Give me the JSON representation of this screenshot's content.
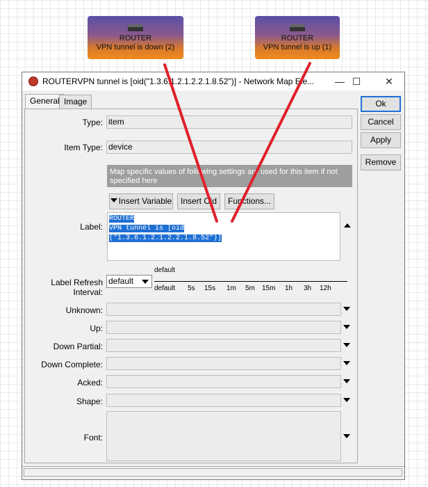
{
  "map_nodes": [
    {
      "name": "ROUTER",
      "status": "VPN tunnel is down (2)"
    },
    {
      "name": "ROUTER",
      "status": "VPN tunnel is up (1)"
    }
  ],
  "window": {
    "title": "ROUTERVPN tunnel is [oid(\"1.3.6.1.2.1.2.2.1.8.52\")] - Network Map Ele...",
    "controls": {
      "minimize": "—",
      "maximize": "☐",
      "close": "✕"
    }
  },
  "tabs": [
    {
      "label": "General"
    },
    {
      "label": "Image"
    }
  ],
  "form": {
    "type_label": "Type:",
    "type_value": "item",
    "item_type_label": "Item Type:",
    "item_type_value": "device",
    "info_text": "Map specific values of following settings are used for this item if not specified here",
    "insert_variable": "Insert Variable",
    "insert_oid": "Insert Oid",
    "functions": "Functions...",
    "label_label": "Label:",
    "label_lines": [
      "ROUTER",
      "VPN tunnel is [oid",
      "(\"1.3.6.1.2.1.2.2.1.8.52\")]"
    ],
    "refresh_label": "Label Refresh Interval:",
    "refresh_value": "default",
    "slider_value_label": "default",
    "slider_ticks": [
      "default",
      "5s",
      "15s",
      "1m",
      "5m",
      "15m",
      "1h",
      "3h",
      "12h"
    ],
    "unknown_label": "Unknown:",
    "up_label": "Up:",
    "down_partial_label": "Down Partial:",
    "down_complete_label": "Down Complete:",
    "acked_label": "Acked:",
    "shape_label": "Shape:",
    "font_label": "Font:"
  },
  "buttons": {
    "ok": "Ok",
    "cancel": "Cancel",
    "apply": "Apply",
    "remove": "Remove"
  },
  "colors": {
    "selection": "#1e6fd4",
    "annotation_line": "#e0202a"
  },
  "icons": [
    "router-icon",
    "app-icon",
    "chevron-down-icon",
    "scroll-up-icon"
  ]
}
